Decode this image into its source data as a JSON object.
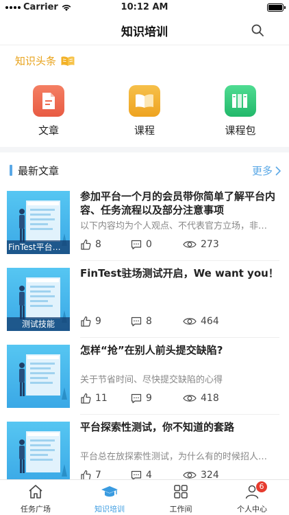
{
  "status_bar": {
    "carrier": "Carrier",
    "time": "10:12 AM"
  },
  "nav": {
    "title": "知识培训"
  },
  "headline": {
    "label": "知识头条"
  },
  "categories": [
    {
      "label": "文章",
      "color": "#ee6a4f"
    },
    {
      "label": "课程",
      "color": "#f0b02a"
    },
    {
      "label": "课程包",
      "color": "#2fcb7b"
    }
  ],
  "section": {
    "title": "最新文章",
    "more": "更多"
  },
  "articles": [
    {
      "title": "参加平台一个月的会员带你简单了解平台内容、任务流程以及部分注意事项",
      "summary": "以下内容均为个人观点、不代表官方立场，非…",
      "tag": "FinTest平台推…",
      "likes": "8",
      "comments": "0",
      "views": "273"
    },
    {
      "title": "FinTest驻场测试开启，We want you！",
      "summary": "",
      "tag": "测试技能",
      "likes": "9",
      "comments": "8",
      "views": "464"
    },
    {
      "title": "怎样“抢”在别人前头提交缺陷?",
      "summary": "关于节省时间、尽快提交缺陷的心得",
      "tag": "",
      "likes": "11",
      "comments": "9",
      "views": "418"
    },
    {
      "title": "平台探索性测试，你不知道的套路",
      "summary": "平台总在放探索性测试，为什么有的时候招人…",
      "tag": "",
      "likes": "7",
      "comments": "4",
      "views": "324"
    }
  ],
  "tabs": [
    {
      "label": "任务广场",
      "icon": "home-icon"
    },
    {
      "label": "知识培训",
      "icon": "graduation-cap-icon",
      "active": true
    },
    {
      "label": "工作间",
      "icon": "grid-icon"
    },
    {
      "label": "个人中心",
      "icon": "person-icon",
      "badge": "6"
    }
  ],
  "colors": {
    "accent": "#3a9be0",
    "headline": "#e8a21a",
    "badge": "#e63b2e"
  }
}
